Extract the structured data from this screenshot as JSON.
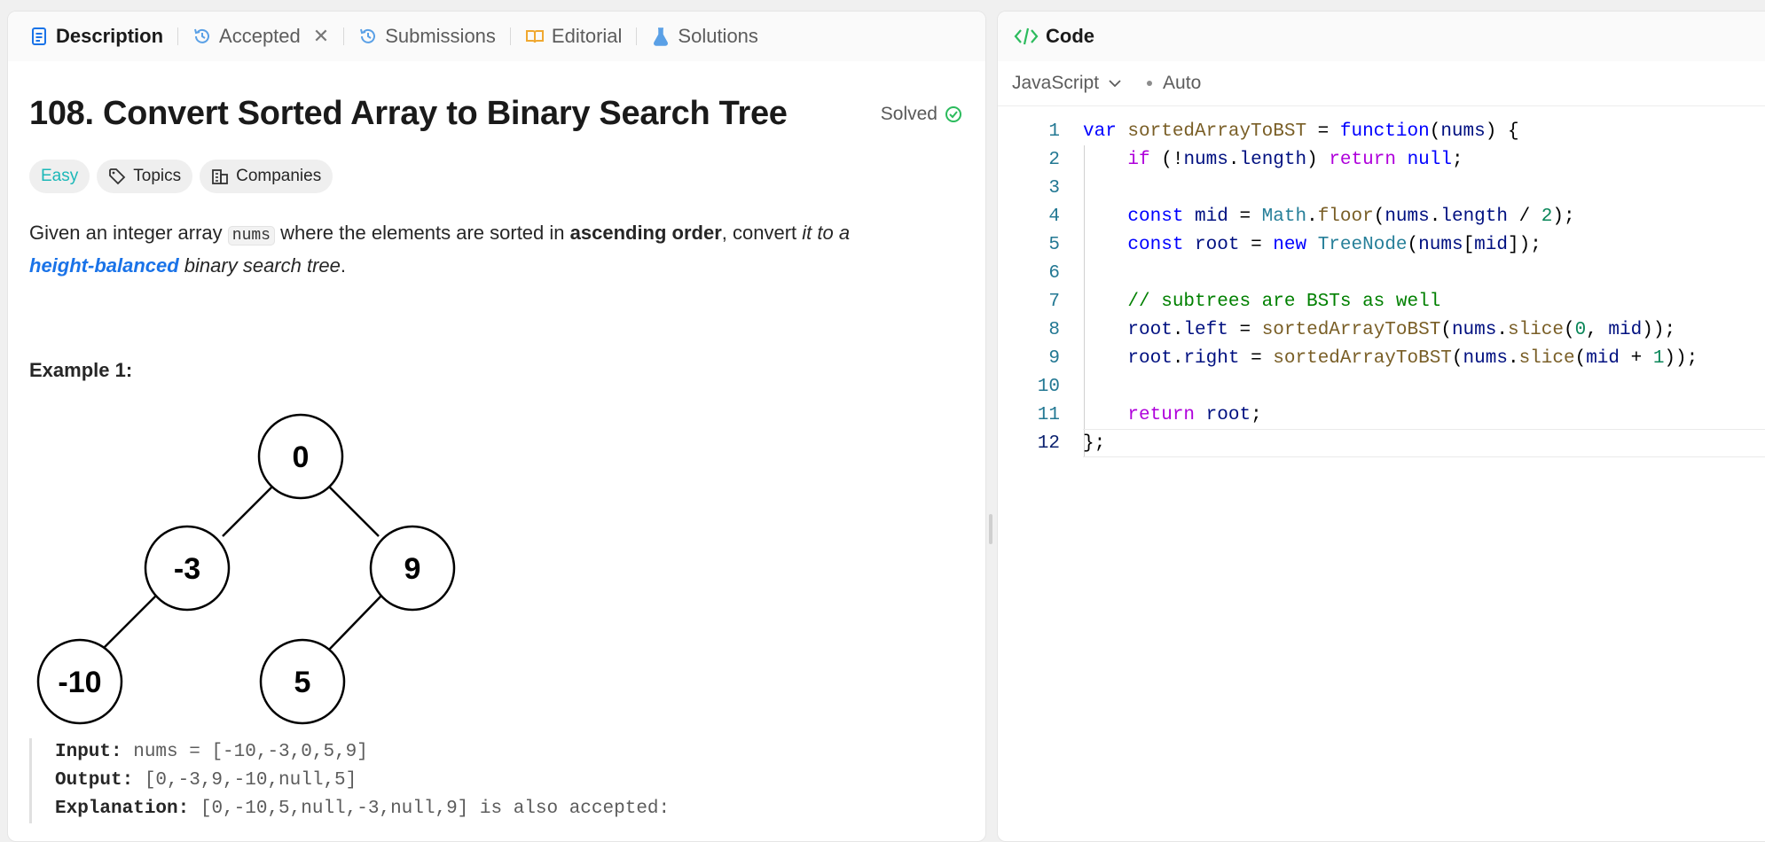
{
  "tabs": [
    {
      "label": "Description",
      "icon": "document-icon",
      "active": true
    },
    {
      "label": "Accepted",
      "icon": "history-icon",
      "active": false
    },
    {
      "label": "Submissions",
      "icon": "history-icon",
      "active": false
    },
    {
      "label": "Editorial",
      "icon": "book-icon",
      "active": false
    },
    {
      "label": "Solutions",
      "icon": "flask-icon",
      "active": false
    }
  ],
  "problem": {
    "title": "108. Convert Sorted Array to Binary Search Tree",
    "status": "Solved",
    "difficulty": "Easy",
    "topics": "Topics",
    "companies": "Companies",
    "desc_1": "Given an integer array ",
    "desc_code": "nums",
    "desc_2": " where the elements are sorted in ",
    "desc_bold": "ascending order",
    "desc_3": ", convert ",
    "desc_it1": "it to a",
    "desc_link": "height-balanced",
    "desc_it2": " binary search tree",
    "desc_end": ".",
    "example_title": "Example 1:",
    "tree_nodes": [
      "0",
      "-3",
      "9",
      "-10",
      "5"
    ],
    "input_label": "Input:",
    "input_value": " nums = [-10,-3,0,5,9]",
    "output_label": "Output:",
    "output_value": " [0,-3,9,-10,null,5]",
    "expl_label": "Explanation:",
    "expl_value": " [0,-10,5,null,-3,null,9] is also accepted:"
  },
  "code_panel": {
    "title": "Code",
    "language": "JavaScript",
    "mode": "Auto",
    "current_line": 12,
    "lines": [
      "var sortedArrayToBST = function(nums) {",
      "    if (!nums.length) return null;",
      "",
      "    const mid = Math.floor(nums.length / 2);",
      "    const root = new TreeNode(nums[mid]);",
      "",
      "    // subtrees are BSTs as well",
      "    root.left = sortedArrayToBST(nums.slice(0, mid));",
      "    root.right = sortedArrayToBST(nums.slice(mid + 1));",
      "",
      "    return root;",
      "};"
    ]
  },
  "colors": {
    "accent": "#1a73e8",
    "easy": "#1cb8b8",
    "solved": "#2cbb5d"
  }
}
